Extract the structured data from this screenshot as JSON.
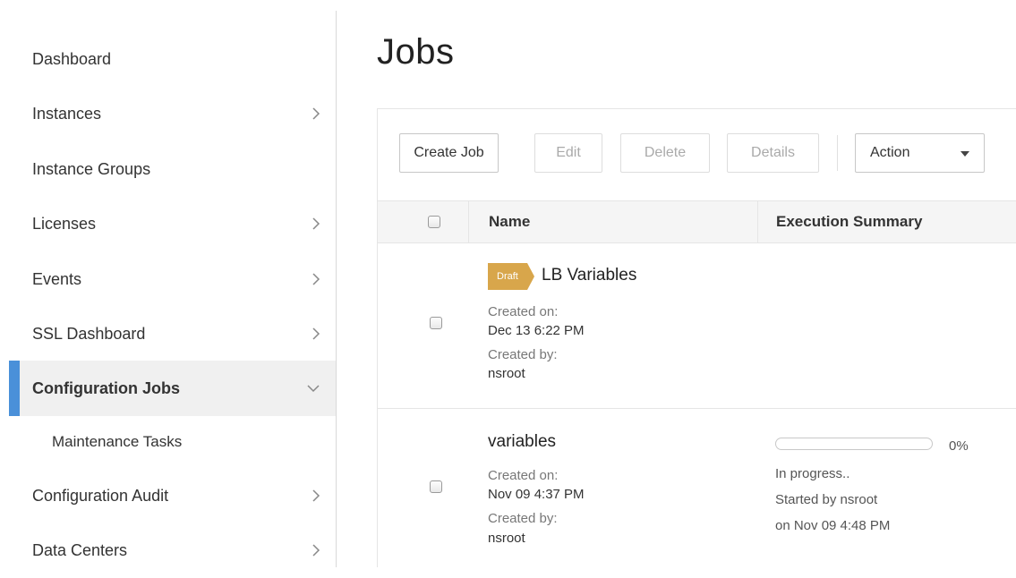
{
  "sidebar": {
    "items": [
      {
        "label": "Dashboard",
        "chevron": "none"
      },
      {
        "label": "Instances",
        "chevron": "right"
      },
      {
        "label": "Instance Groups",
        "chevron": "none"
      },
      {
        "label": "Licenses",
        "chevron": "right"
      },
      {
        "label": "Events",
        "chevron": "right"
      },
      {
        "label": "SSL Dashboard",
        "chevron": "right"
      },
      {
        "label": "Configuration Jobs",
        "chevron": "down",
        "active": true
      },
      {
        "label": "Maintenance Tasks",
        "chevron": "none",
        "sub": true
      },
      {
        "label": "Configuration Audit",
        "chevron": "right"
      },
      {
        "label": "Data Centers",
        "chevron": "right"
      }
    ],
    "accent_color": "#4a90d9"
  },
  "page": {
    "title": "Jobs"
  },
  "toolbar": {
    "create_label": "Create Job",
    "edit_label": "Edit",
    "delete_label": "Delete",
    "details_label": "Details",
    "action_label": "Action"
  },
  "table": {
    "headers": {
      "name": "Name",
      "execution": "Execution Summary"
    },
    "rows": [
      {
        "badge": "Draft",
        "name": "LB Variables",
        "created_on_label": "Created on:",
        "created_on": "Dec 13 6:22 PM",
        "created_by_label": "Created by:",
        "created_by": "nsroot"
      },
      {
        "name": "variables",
        "created_on_label": "Created on:",
        "created_on": "Nov 09 4:37 PM",
        "created_by_label": "Created by:",
        "created_by": "nsroot",
        "progress": 0,
        "progress_label": "0%",
        "status": "In progress..",
        "started_by": "Started by  nsroot",
        "started_on": "on  Nov 09 4:48 PM"
      }
    ]
  },
  "colors": {
    "badge": "#d8a64b",
    "accent": "#4a90d9"
  }
}
